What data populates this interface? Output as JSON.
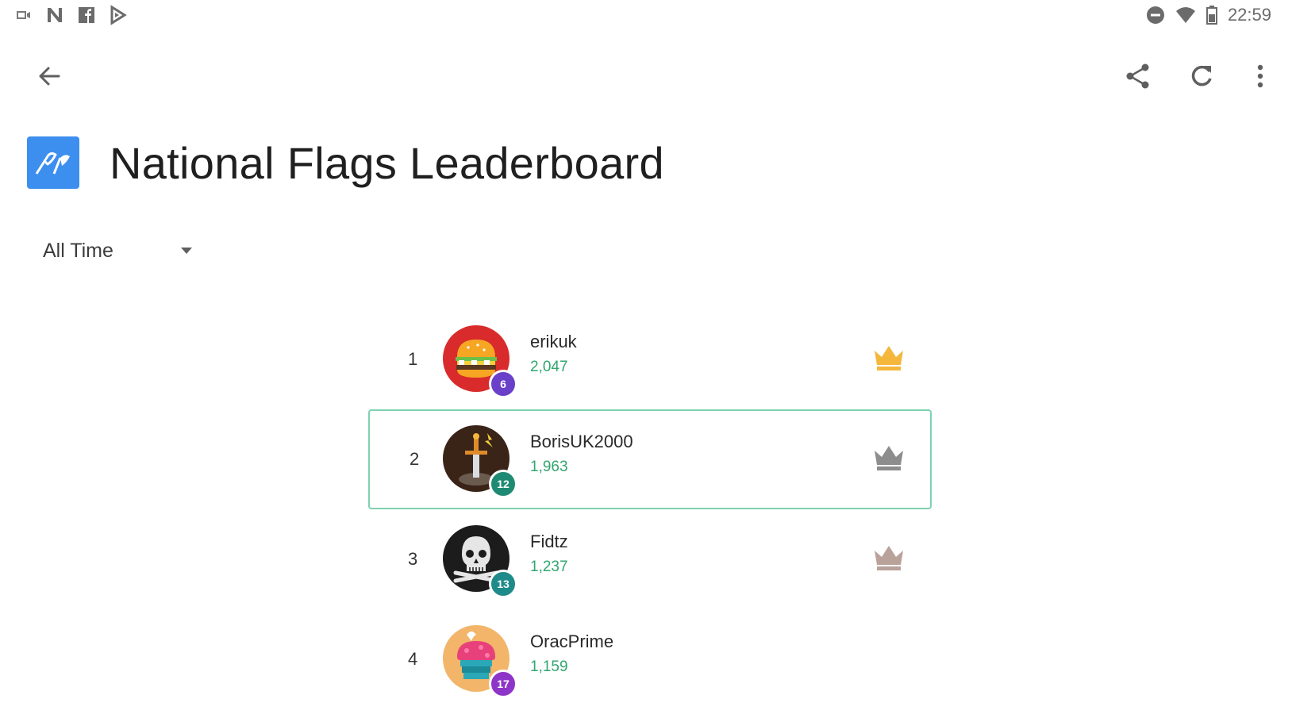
{
  "status_bar": {
    "time": "22:59",
    "left_icons": [
      "cast-icon",
      "n-app-icon",
      "facebook-icon",
      "play-games-icon"
    ],
    "right_icons": [
      "do-not-disturb-icon",
      "wifi-icon",
      "battery-icon"
    ]
  },
  "app_bar": {
    "icons": [
      "back-arrow-icon",
      "share-icon",
      "refresh-icon",
      "more-vert-icon"
    ]
  },
  "header": {
    "title": "National Flags Leaderboard",
    "logo_icon": "flags-icon",
    "logo_color": "#3d8fef"
  },
  "filter": {
    "selected": "All Time"
  },
  "leaderboard": [
    {
      "rank": "1",
      "name": "erikuk",
      "score": "2,047",
      "level": "6",
      "avatar": "burger-avatar",
      "avatar_bg": "#d92b2b",
      "badge_color": "#6a3fc9",
      "crown": "gold-crown-icon",
      "crown_color": "#f4b73c",
      "highlighted": false
    },
    {
      "rank": "2",
      "name": "BorisUK2000",
      "score": "1,963",
      "level": "12",
      "avatar": "sword-avatar",
      "avatar_bg": "#3a2418",
      "badge_color": "#1f8a73",
      "crown": "silver-crown-icon",
      "crown_color": "#8d8d8d",
      "highlighted": true
    },
    {
      "rank": "3",
      "name": "Fidtz",
      "score": "1,237",
      "level": "13",
      "avatar": "skull-avatar",
      "avatar_bg": "#1c1c1c",
      "badge_color": "#1f8a8a",
      "crown": "bronze-crown-icon",
      "crown_color": "#b9a29a",
      "highlighted": false
    },
    {
      "rank": "4",
      "name": "OracPrime",
      "score": "1,159",
      "level": "17",
      "avatar": "cupcake-avatar",
      "avatar_bg": "#f2b56a",
      "badge_color": "#8e35c9",
      "crown": "",
      "crown_color": "",
      "highlighted": false
    }
  ],
  "colors": {
    "accent_green": "#31a66f",
    "highlight_border": "#7fd1b0"
  }
}
